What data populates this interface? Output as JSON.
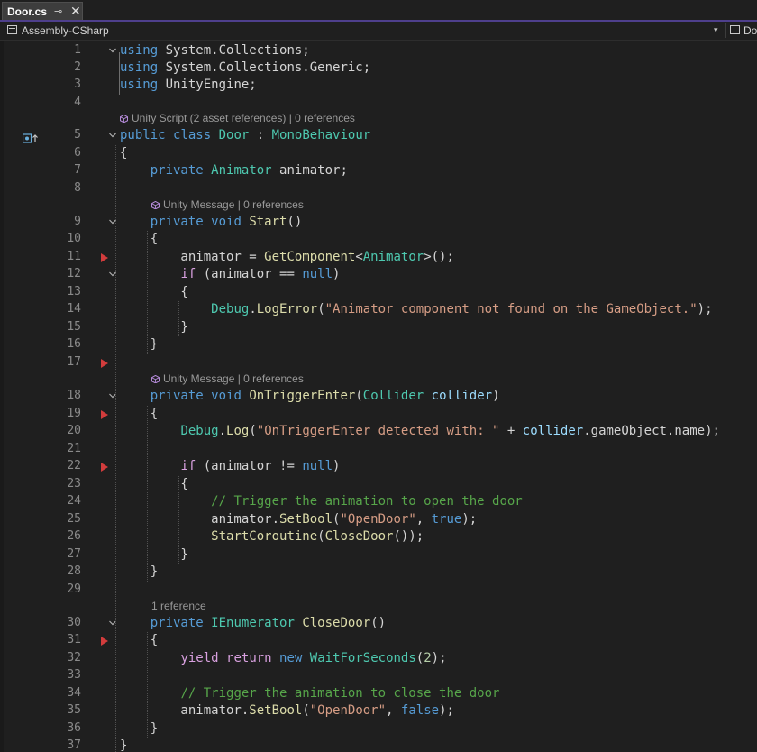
{
  "tab": {
    "title": "Door.cs",
    "pin": "⊸",
    "close": "✕"
  },
  "navbar": {
    "project": "Assembly-CSharp",
    "right_label": "Do"
  },
  "lens": {
    "class": "Unity Script (2 asset references) | 0 references",
    "start": "Unity Message | 0 references",
    "trigger": "Unity Message | 0 references",
    "close_door": "1 reference"
  },
  "lines": [
    {
      "n": "1",
      "tokens": [
        [
          "kw",
          "using"
        ],
        [
          "t",
          " System.Collections;"
        ]
      ]
    },
    {
      "n": "2",
      "tokens": [
        [
          "kw",
          "using"
        ],
        [
          "t",
          " System.Collections.Generic;"
        ]
      ]
    },
    {
      "n": "3",
      "tokens": [
        [
          "kw",
          "using"
        ],
        [
          "t",
          " UnityEngine;"
        ]
      ]
    },
    {
      "n": "4",
      "tokens": []
    },
    {
      "n": "5",
      "tokens": [
        [
          "kw",
          "public"
        ],
        [
          "t",
          " "
        ],
        [
          "kw",
          "class"
        ],
        [
          "t",
          " "
        ],
        [
          "type",
          "Door"
        ],
        [
          "t",
          " : "
        ],
        [
          "type",
          "MonoBehaviour"
        ]
      ]
    },
    {
      "n": "6",
      "tokens": [
        [
          "t",
          "{"
        ]
      ]
    },
    {
      "n": "7",
      "tokens": [
        [
          "t",
          "    "
        ],
        [
          "kw",
          "private"
        ],
        [
          "t",
          " "
        ],
        [
          "type",
          "Animator"
        ],
        [
          "t",
          " animator;"
        ]
      ]
    },
    {
      "n": "8",
      "tokens": []
    },
    {
      "n": "9",
      "tokens": [
        [
          "t",
          "    "
        ],
        [
          "kw",
          "private"
        ],
        [
          "t",
          " "
        ],
        [
          "kw",
          "void"
        ],
        [
          "t",
          " "
        ],
        [
          "method",
          "Start"
        ],
        [
          "t",
          "()"
        ]
      ]
    },
    {
      "n": "10",
      "tokens": [
        [
          "t",
          "    {"
        ]
      ]
    },
    {
      "n": "11",
      "tokens": [
        [
          "t",
          "        animator = "
        ],
        [
          "method",
          "GetComponent"
        ],
        [
          "t",
          "<"
        ],
        [
          "type",
          "Animator"
        ],
        [
          "t",
          ">();"
        ]
      ]
    },
    {
      "n": "12",
      "tokens": [
        [
          "t",
          "        "
        ],
        [
          "ctl",
          "if"
        ],
        [
          "t",
          " (animator == "
        ],
        [
          "kw",
          "null"
        ],
        [
          "t",
          ")"
        ]
      ]
    },
    {
      "n": "13",
      "tokens": [
        [
          "t",
          "        {"
        ]
      ]
    },
    {
      "n": "14",
      "tokens": [
        [
          "t",
          "            "
        ],
        [
          "type",
          "Debug"
        ],
        [
          "t",
          "."
        ],
        [
          "method",
          "LogError"
        ],
        [
          "t",
          "("
        ],
        [
          "str",
          "\"Animator component not found on the GameObject.\""
        ],
        [
          "t",
          ");"
        ]
      ]
    },
    {
      "n": "15",
      "tokens": [
        [
          "t",
          "        }"
        ]
      ]
    },
    {
      "n": "16",
      "tokens": [
        [
          "t",
          "    }"
        ]
      ]
    },
    {
      "n": "17",
      "tokens": []
    },
    {
      "n": "18",
      "tokens": [
        [
          "t",
          "    "
        ],
        [
          "kw",
          "private"
        ],
        [
          "t",
          " "
        ],
        [
          "kw",
          "void"
        ],
        [
          "t",
          " "
        ],
        [
          "method",
          "OnTriggerEnter"
        ],
        [
          "t",
          "("
        ],
        [
          "type",
          "Collider"
        ],
        [
          "t",
          " "
        ],
        [
          "var",
          "collider"
        ],
        [
          "t",
          ")"
        ]
      ]
    },
    {
      "n": "19",
      "tokens": [
        [
          "t",
          "    {"
        ]
      ]
    },
    {
      "n": "20",
      "tokens": [
        [
          "t",
          "        "
        ],
        [
          "type",
          "Debug"
        ],
        [
          "t",
          "."
        ],
        [
          "method",
          "Log"
        ],
        [
          "t",
          "("
        ],
        [
          "str",
          "\"OnTriggerEnter detected with: \""
        ],
        [
          "t",
          " + "
        ],
        [
          "var",
          "collider"
        ],
        [
          "t",
          ".gameObject.name);"
        ]
      ]
    },
    {
      "n": "21",
      "tokens": []
    },
    {
      "n": "22",
      "tokens": [
        [
          "t",
          "        "
        ],
        [
          "ctl",
          "if"
        ],
        [
          "t",
          " (animator != "
        ],
        [
          "kw",
          "null"
        ],
        [
          "t",
          ")"
        ]
      ]
    },
    {
      "n": "23",
      "tokens": [
        [
          "t",
          "        {"
        ]
      ]
    },
    {
      "n": "24",
      "tokens": [
        [
          "t",
          "            "
        ],
        [
          "cmt",
          "// Trigger the animation to open the door"
        ]
      ]
    },
    {
      "n": "25",
      "tokens": [
        [
          "t",
          "            animator."
        ],
        [
          "method",
          "SetBool"
        ],
        [
          "t",
          "("
        ],
        [
          "str",
          "\"OpenDoor\""
        ],
        [
          "t",
          ", "
        ],
        [
          "kw",
          "true"
        ],
        [
          "t",
          ");"
        ]
      ]
    },
    {
      "n": "26",
      "tokens": [
        [
          "t",
          "            "
        ],
        [
          "method",
          "StartCoroutine"
        ],
        [
          "t",
          "("
        ],
        [
          "method",
          "CloseDoor"
        ],
        [
          "t",
          "());"
        ]
      ]
    },
    {
      "n": "27",
      "tokens": [
        [
          "t",
          "        }"
        ]
      ]
    },
    {
      "n": "28",
      "tokens": [
        [
          "t",
          "    }"
        ]
      ]
    },
    {
      "n": "29",
      "tokens": []
    },
    {
      "n": "30",
      "tokens": [
        [
          "t",
          "    "
        ],
        [
          "kw",
          "private"
        ],
        [
          "t",
          " "
        ],
        [
          "type",
          "IEnumerator"
        ],
        [
          "t",
          " "
        ],
        [
          "method",
          "CloseDoor"
        ],
        [
          "t",
          "()"
        ]
      ]
    },
    {
      "n": "31",
      "tokens": [
        [
          "t",
          "    {"
        ]
      ]
    },
    {
      "n": "32",
      "tokens": [
        [
          "t",
          "        "
        ],
        [
          "ctl",
          "yield"
        ],
        [
          "t",
          " "
        ],
        [
          "ctl",
          "return"
        ],
        [
          "t",
          " "
        ],
        [
          "kw",
          "new"
        ],
        [
          "t",
          " "
        ],
        [
          "type",
          "WaitForSeconds"
        ],
        [
          "t",
          "("
        ],
        [
          "num",
          "2"
        ],
        [
          "t",
          ");"
        ]
      ]
    },
    {
      "n": "33",
      "tokens": []
    },
    {
      "n": "34",
      "tokens": [
        [
          "t",
          "        "
        ],
        [
          "cmt",
          "// Trigger the animation to close the door"
        ]
      ]
    },
    {
      "n": "35",
      "tokens": [
        [
          "t",
          "        animator."
        ],
        [
          "method",
          "SetBool"
        ],
        [
          "t",
          "("
        ],
        [
          "str",
          "\"OpenDoor\""
        ],
        [
          "t",
          ", "
        ],
        [
          "kw",
          "false"
        ],
        [
          "t",
          ");"
        ]
      ]
    },
    {
      "n": "36",
      "tokens": [
        [
          "t",
          "    }"
        ]
      ]
    },
    {
      "n": "37",
      "tokens": [
        [
          "t",
          "}"
        ]
      ]
    }
  ],
  "breakpoint_lines": [
    "11",
    "17",
    "19",
    "22",
    "31"
  ],
  "fold_lines": [
    "1",
    "5",
    "9",
    "12",
    "18",
    "30"
  ]
}
